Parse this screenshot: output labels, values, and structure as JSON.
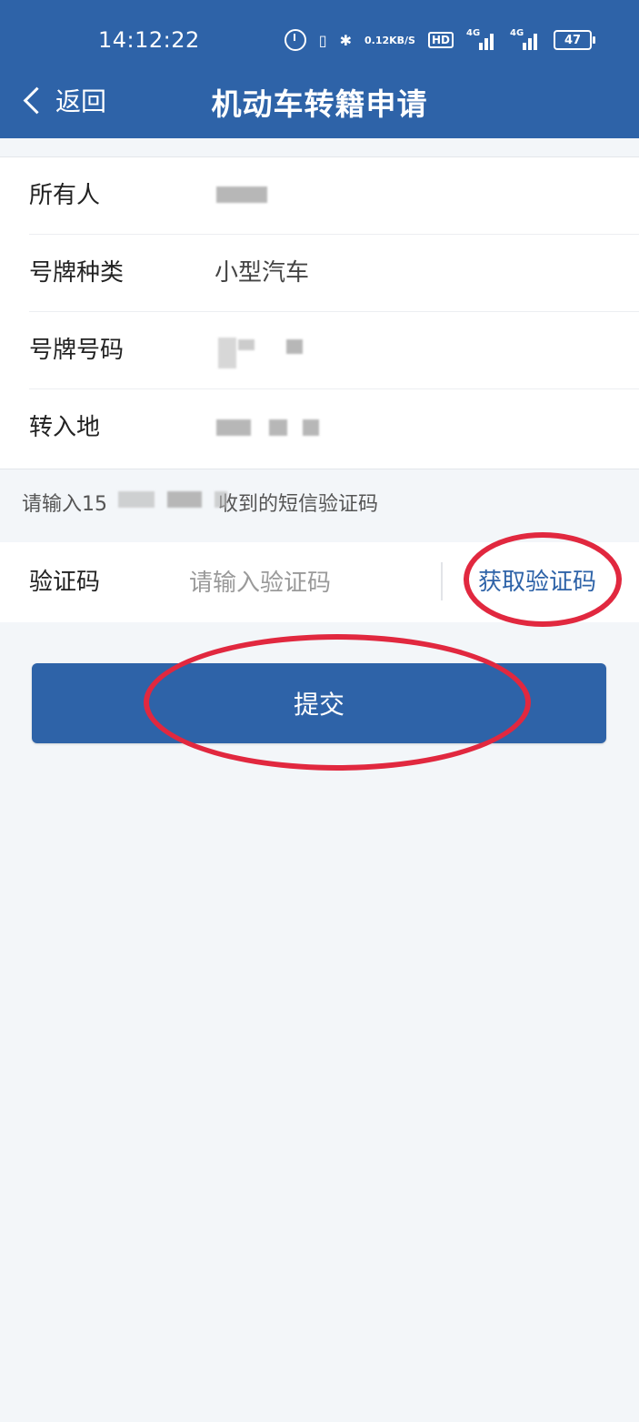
{
  "status_bar": {
    "time": "14:12:22",
    "speed_top": "0.12",
    "speed_bottom": "KB/S",
    "hd": "HD",
    "net1": "4G",
    "net2": "4G",
    "battery": "47"
  },
  "header": {
    "back_label": "返回",
    "title": "机动车转籍申请"
  },
  "info": {
    "owner_label": "所有人",
    "plate_type_label": "号牌种类",
    "plate_type_value": "小型汽车",
    "plate_number_label": "号牌号码",
    "destination_label": "转入地"
  },
  "sms": {
    "hint_prefix": "请输入15",
    "hint_suffix": "收到的短信验证码"
  },
  "verify": {
    "label": "验证码",
    "placeholder": "请输入验证码",
    "get_code": "获取验证码"
  },
  "submit_label": "提交",
  "colors": {
    "brand": "#2e63a8",
    "annotation": "#e1283f",
    "background": "#f3f6f9"
  }
}
